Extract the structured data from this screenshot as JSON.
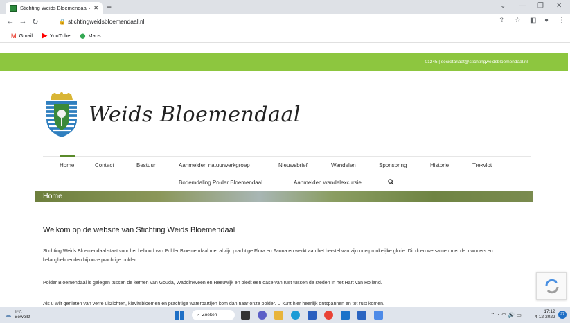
{
  "browser": {
    "tab_title": "Stichting Weids Bloemendaal – St",
    "tab_close": "✕",
    "new_tab": "+",
    "url": "stichtingweidsbloemendaal.nl",
    "bookmarks": [
      {
        "label": "Gmail",
        "icon": "gmail-icon",
        "glyph": "M",
        "color": "#ea4335"
      },
      {
        "label": "YouTube",
        "icon": "youtube-icon",
        "glyph": "▶",
        "color": "#ff0000"
      },
      {
        "label": "Maps",
        "icon": "maps-icon",
        "glyph": "⬤",
        "color": "#34a853"
      }
    ]
  },
  "site": {
    "top_info": "01245 | secretariaat@stichtingweidsbloemendaal.nl",
    "logo_text": "Weids Bloemendaal",
    "nav_row1": [
      "Home",
      "Contact",
      "Bestuur",
      "Aanmelden natuurwerkgroep",
      "Nieuwsbrief",
      "Wandelen",
      "Sponsoring",
      "Historie",
      "Trekvlot"
    ],
    "nav_row2": [
      "Bodemdaling Polder Bloemendaal",
      "Aanmelden wandelexcursie"
    ],
    "banner_title": "Home",
    "welcome_heading": "Welkom op de website van Stichting Weids Bloemendaal",
    "paragraphs": [
      "Stichting Weids Bloemendaal staat voor het behoud van Polder Bloemendaal met al zijn prachtige Flora en Fauna en werkt aan het herstel van zijn oorspronkelijke glorie. Dit doen we samen met de inwoners en belanghebbenden bij onze prachtige polder.",
      "Polder Bloemendaal is gelegen tussen de kernen van Gouda, Waddinxveen en Reeuwijk en biedt een oase van rust tussen de steden in het Hart van Holland.",
      "Als u wilt genieten van verre uitzichten, kievitsbloemen en prachtige waterpartijen kom dan naar onze polder. U kunt hier heerlijk ontspannen en tot rust komen."
    ]
  },
  "taskbar": {
    "temp": "1°C",
    "weather": "Bewolkt",
    "search_label": "Zoeken",
    "time": "17:12",
    "date": "4-12-2022",
    "notifications": "27"
  },
  "colors": {
    "topbar": "#8dc63f",
    "nav_active": "#5a8a2a"
  }
}
